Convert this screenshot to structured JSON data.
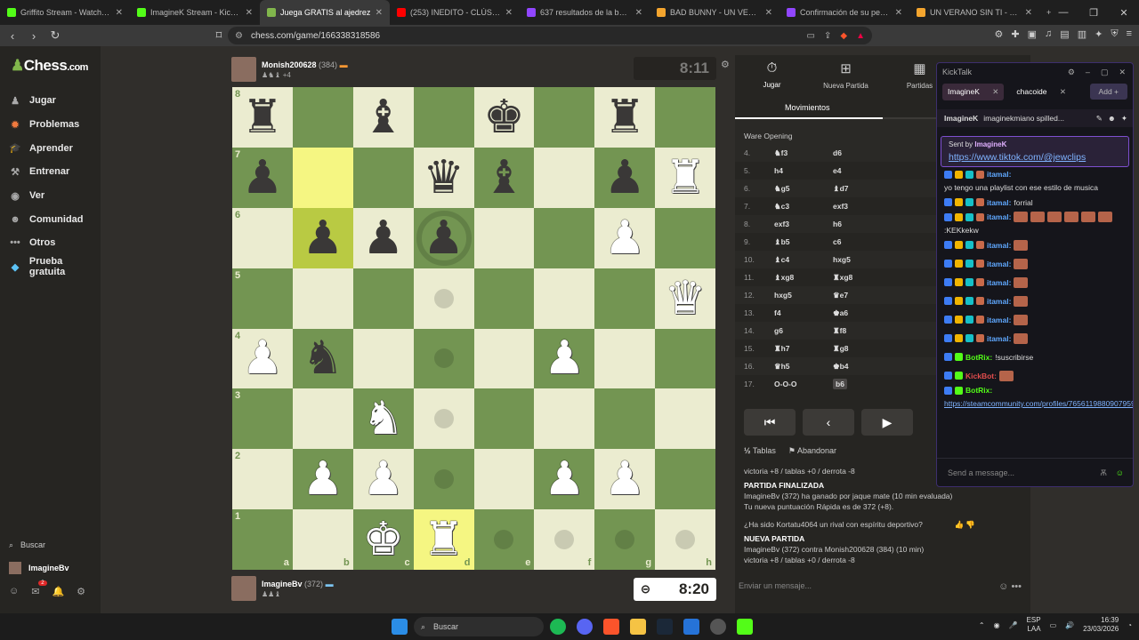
{
  "browser": {
    "tabs": [
      {
        "title": "Griffito Stream - Watch Live on",
        "color": "#53fc18",
        "active": false
      },
      {
        "title": "ImagineK Stream - Kick Da",
        "color": "#53fc18",
        "active": false
      },
      {
        "title": "Juega GRATIS al ajedrez",
        "color": "#81b64c",
        "active": true
      },
      {
        "title": "(253) INEDITO - CLÚSTER - EN",
        "color": "#ff0000",
        "active": false
      },
      {
        "title": "637 resultados de la búsqueda",
        "color": "#9146ff",
        "active": false
      },
      {
        "title": "BAD BUNNY - UN VERANO",
        "color": "#f4a52e",
        "active": false
      },
      {
        "title": "Confirmación de su pedido - N",
        "color": "#9146ff",
        "active": false
      },
      {
        "title": "UN VERANO SIN TI - BAD",
        "color": "#f4a52e",
        "active": false
      }
    ],
    "url": "chess.com/game/166338318586"
  },
  "sidebar": {
    "logo_text": "Chess",
    "logo_suffix": ".com",
    "items": [
      {
        "label": "Jugar",
        "icon": "♟"
      },
      {
        "label": "Problemas",
        "icon": "✹"
      },
      {
        "label": "Aprender",
        "icon": "🎓"
      },
      {
        "label": "Entrenar",
        "icon": "⚒"
      },
      {
        "label": "Ver",
        "icon": "◉"
      },
      {
        "label": "Comunidad",
        "icon": "☻"
      },
      {
        "label": "Otros",
        "icon": "•••"
      },
      {
        "label": "Prueba gratuita",
        "icon": "◆"
      }
    ],
    "search_label": "Buscar",
    "user_label": "ImagineBv",
    "notif_count": "2"
  },
  "top_player": {
    "name": "Monish200628",
    "rating": "(384)",
    "extra": "+4",
    "clock": "8:11"
  },
  "bottom_player": {
    "name": "ImagineBv",
    "rating": "(372)",
    "clock": "8:20"
  },
  "board": {
    "rows": [
      [
        "bR",
        "",
        "bB",
        "",
        "bK",
        "",
        "bR",
        ""
      ],
      [
        "bP",
        "",
        "",
        "bQ",
        "bB",
        "",
        "bP",
        "wR"
      ],
      [
        "",
        "bP",
        "bP",
        "bP",
        "",
        "",
        "wP",
        ""
      ],
      [
        "",
        "",
        "",
        "",
        "",
        "",
        "",
        "wQ"
      ],
      [
        "wP",
        "bN",
        "",
        "",
        "",
        "wP",
        "",
        ""
      ],
      [
        "",
        "",
        "wN",
        "",
        "",
        "",
        "",
        ""
      ],
      [
        "",
        "wP",
        "wP",
        "",
        "",
        "wP",
        "wP",
        ""
      ],
      [
        "",
        "",
        "wK",
        "wR",
        "",
        "",
        "",
        ""
      ]
    ],
    "highlights": [
      "b7",
      "b6",
      "d1"
    ],
    "dots": [
      "d5",
      "d4",
      "d3",
      "d2",
      "e1",
      "f1",
      "g1",
      "h1"
    ],
    "rings": [
      "d6"
    ],
    "files": [
      "a",
      "b",
      "c",
      "d",
      "e",
      "f",
      "g",
      "h"
    ],
    "ranks": [
      "8",
      "7",
      "6",
      "5",
      "4",
      "3",
      "2",
      "1"
    ]
  },
  "panel": {
    "tabs": [
      {
        "label": "Jugar",
        "icon": "⏱"
      },
      {
        "label": "Nueva Partida",
        "icon": "⊞"
      },
      {
        "label": "Partidas",
        "icon": "▦"
      }
    ],
    "moves_header": "Movimientos",
    "opening": "Ware Opening",
    "moves": [
      {
        "n": "4.",
        "w": "♞f3",
        "b": "d6"
      },
      {
        "n": "5.",
        "w": "h4",
        "b": "e4"
      },
      {
        "n": "6.",
        "w": "♞g5",
        "b": "♝d7"
      },
      {
        "n": "7.",
        "w": "♞c3",
        "b": "exf3"
      },
      {
        "n": "8.",
        "w": "exf3",
        "b": "h6"
      },
      {
        "n": "9.",
        "w": "♝b5",
        "b": "c6"
      },
      {
        "n": "10.",
        "w": "♝c4",
        "b": "hxg5"
      },
      {
        "n": "11.",
        "w": "♝xg8",
        "b": "♜xg8"
      },
      {
        "n": "12.",
        "w": "hxg5",
        "b": "♛e7"
      },
      {
        "n": "13.",
        "w": "f4",
        "b": "♚a6"
      },
      {
        "n": "14.",
        "w": "g6",
        "b": "♜f8"
      },
      {
        "n": "15.",
        "w": "♜h7",
        "b": "♜g8"
      },
      {
        "n": "16.",
        "w": "♛h5",
        "b": "♚b4"
      },
      {
        "n": "17.",
        "w": "O-O-O",
        "b": "b6"
      }
    ],
    "draw_label": "Tablas",
    "resign_label": "Abandonar",
    "log": {
      "l1": "victoria +8 / tablas +0 / derrota -8",
      "l2": "PARTIDA FINALIZADA",
      "l3": "ImagineBv (372) ha ganado por jaque mate (10 min evaluada)",
      "l4": "Tu nueva puntuación Rápida es de 372 (+8).",
      "l5": "¿Ha sido Kortatu4064 un rival con espíritu deportivo?",
      "l6": "NUEVA PARTIDA",
      "l7": "ImagineBv (372) contra Monish200628 (384) (10 min)",
      "l8": "victoria +8 / tablas +0 / derrota -8"
    },
    "chat_placeholder": "Enviar un mensaje..."
  },
  "kick": {
    "title": "KickTalk",
    "tabs": [
      "ImagineK",
      "chacoide"
    ],
    "add_label": "Add +",
    "header": "ImagineK",
    "header_msg": "imaginekmiano spilled...",
    "pinned_by": "Sent by",
    "pinned_user": "ImagineK",
    "pinned_link": "https://www.tiktok.com/@jewclips",
    "messages": [
      {
        "user": "itamal:",
        "text": "yo tengo una playlist con ese estilo de musica",
        "type": "user",
        "emotes": 0
      },
      {
        "user": "itamal:",
        "text": "forrial",
        "type": "user",
        "emotes": 0
      },
      {
        "user": "itamal:",
        "text": ":KEKkekw",
        "type": "user",
        "emotes": 6
      },
      {
        "user": "itamal:",
        "text": "",
        "type": "user",
        "emotes": 1
      },
      {
        "user": "itamal:",
        "text": "",
        "type": "user",
        "emotes": 1
      },
      {
        "user": "itamal:",
        "text": "",
        "type": "user",
        "emotes": 1
      },
      {
        "user": "itamal:",
        "text": "",
        "type": "user",
        "emotes": 1
      },
      {
        "user": "itamal:",
        "text": "",
        "type": "user",
        "emotes": 1
      },
      {
        "user": "itamal:",
        "text": "",
        "type": "user",
        "emotes": 1
      },
      {
        "user": "BotRix:",
        "text": "!suscribirse",
        "type": "bot",
        "emotes": 0
      },
      {
        "user": "KickBot:",
        "text": "",
        "type": "kb",
        "emotes": 0
      },
      {
        "user": "BotRix:",
        "text": "https://steamcommunity.com/profiles/76561198809079593/",
        "type": "bot",
        "emotes": 0
      }
    ],
    "send_placeholder": "Send a message..."
  },
  "taskbar": {
    "search": "Buscar",
    "lang": "ESP",
    "lang2": "LAA",
    "time": "16:39",
    "date": "23/03/2026"
  }
}
